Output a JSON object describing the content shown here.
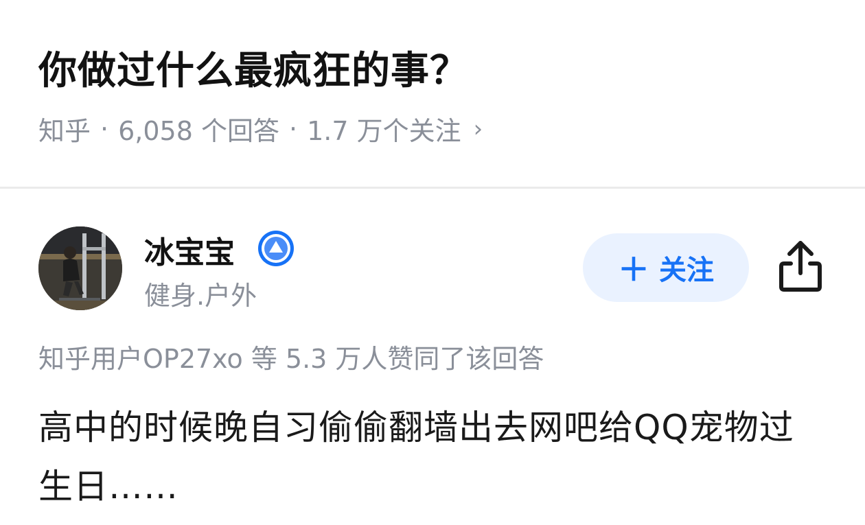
{
  "question": {
    "title": "你做过什么最疯狂的事？",
    "source": "知乎",
    "separator": "·",
    "answers_count": "6,058 个回答",
    "followers_count": "1.7 万个关注",
    "chevron": "›"
  },
  "author": {
    "name": "冰宝宝",
    "bio": "健身.户外",
    "badge_icon": "verified-badge-icon",
    "avatar_icon": "user-avatar"
  },
  "actions": {
    "follow_plus": "＋",
    "follow_label": "关注",
    "share_icon": "share-icon",
    "accent_color": "#1772f6",
    "follow_bg": "#eaf2ff"
  },
  "answer": {
    "voters_text": "知乎用户OP27xo 等 5.3 万人赞同了该回答",
    "content": "高中的时候晚自习偷偷翻墙出去网吧给QQ宠物过生日……"
  }
}
